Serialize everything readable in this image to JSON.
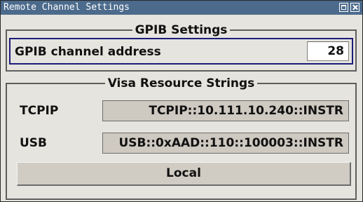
{
  "window": {
    "title": "Remote Channel Settings",
    "restore_icon": "restore-icon",
    "close_icon": "close-icon",
    "titlebar_color": "#4c6b8c"
  },
  "gpib": {
    "group_title": "GPIB Settings",
    "address_label": "GPIB channel address",
    "address_value": "28"
  },
  "visa": {
    "group_title": "Visa Resource Strings",
    "tcpip_label": "TCPIP",
    "tcpip_value": "TCPIP::10.111.10.240::INSTR",
    "usb_label": "USB",
    "usb_value": "USB::0xAAD::110::100003::INSTR",
    "local_button": "Local"
  }
}
